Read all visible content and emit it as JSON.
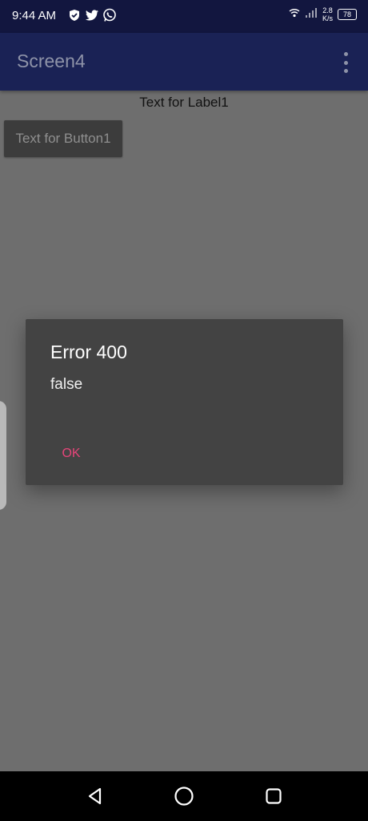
{
  "status_bar": {
    "time": "9:44 AM",
    "left_icons": [
      "shield-icon",
      "twitter-icon",
      "whatsapp-icon"
    ],
    "right_icons": [
      "wifi-icon",
      "signal-icon"
    ],
    "net_speed_value": "2.8",
    "net_speed_unit": "K/s",
    "battery_level": "78"
  },
  "app_bar": {
    "title": "Screen4",
    "menu_icon": "overflow-menu-icon"
  },
  "content": {
    "label1": "Text for Label1",
    "button1": "Text for Button1"
  },
  "dialog": {
    "title": "Error 400",
    "message": "false",
    "ok_label": "OK"
  },
  "nav_bar": {
    "buttons": [
      "back-icon",
      "home-icon",
      "recents-icon"
    ]
  },
  "colors": {
    "status_bar": "#12163f",
    "app_bar": "#1a2255",
    "background_dimmed": "#6e6e6e",
    "dialog": "#434343",
    "accent": "#e8457a"
  }
}
